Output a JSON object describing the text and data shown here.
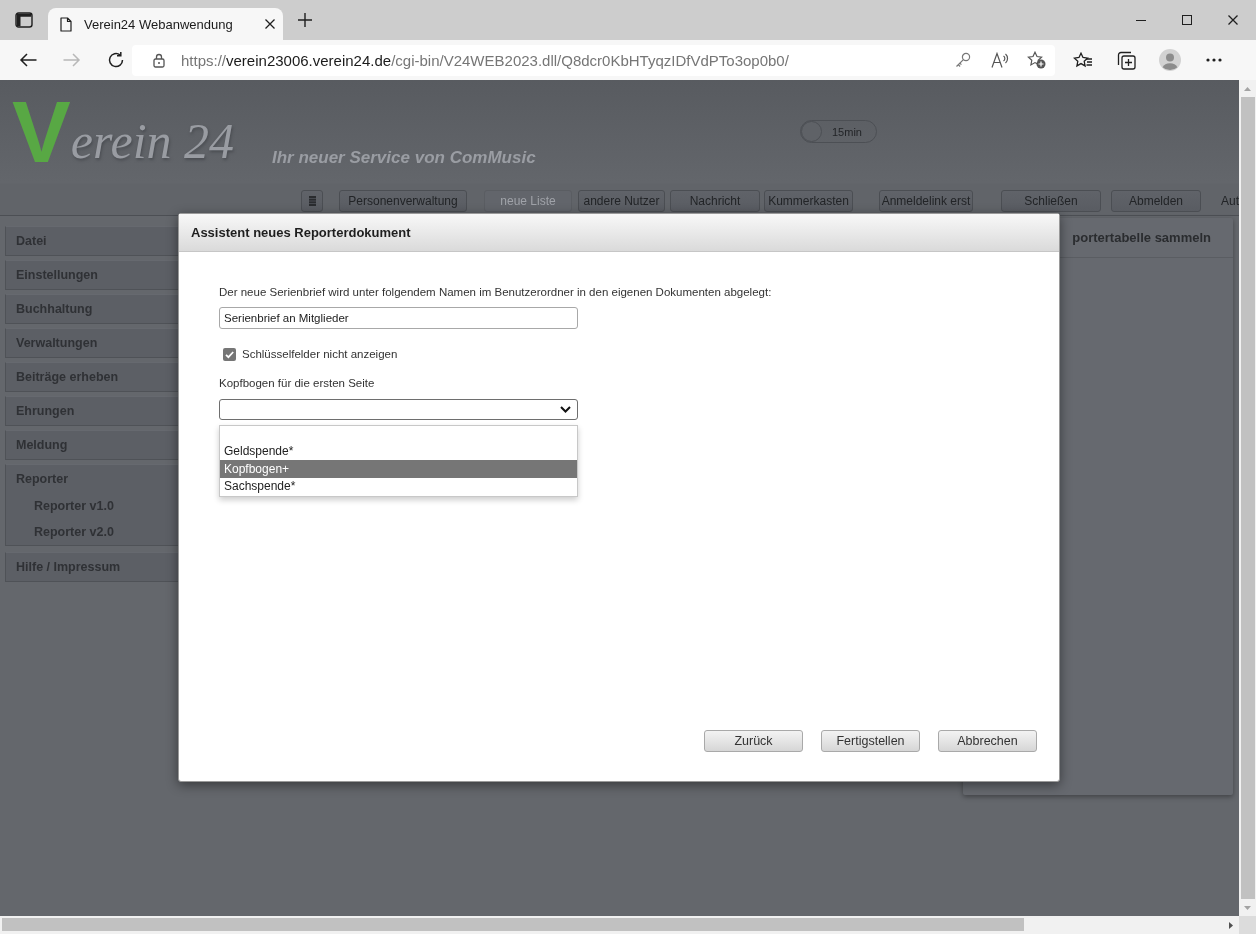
{
  "browser": {
    "tab": {
      "title": "Verein24 Webanwendung"
    },
    "nav": [
      {
        "kind": "back",
        "disabled": false
      },
      {
        "kind": "forward",
        "disabled": true
      },
      {
        "kind": "reload",
        "disabled": false
      }
    ],
    "url": {
      "scheme": "https://",
      "host": "verein23006.verein24.de",
      "path": "/cgi-bin/V24WEB2023.dll/Q8dcr0KbHTyqzIDfVdPTo3op0b0/"
    }
  },
  "header": {
    "logo": {
      "initial": "V",
      "text": "erein 24"
    },
    "tagline": "Ihr neuer Service von ComMusic",
    "timeout_toggle": {
      "label": "15min",
      "on": false
    }
  },
  "toolbar": {
    "buttons": [
      {
        "kind": "icon",
        "disabled": false
      },
      {
        "kind": "text",
        "label": "Personenverwaltung",
        "disabled": false
      },
      {
        "kind": "text",
        "label": "neue Liste",
        "disabled": true
      },
      {
        "kind": "text",
        "label": "andere Nutzer",
        "disabled": false
      },
      {
        "kind": "text",
        "label": "Nachricht",
        "disabled": false
      },
      {
        "kind": "text",
        "label": "Kummerkasten",
        "disabled": false
      },
      {
        "kind": "text",
        "label": "Anmeldelink erst",
        "disabled": false
      },
      {
        "kind": "text",
        "label": "Schließen",
        "disabled": false
      },
      {
        "kind": "text",
        "label": "Abmelden",
        "disabled": false
      }
    ],
    "trailing_text": "Aut"
  },
  "sidebar": {
    "items": [
      {
        "label": "Datei"
      },
      {
        "label": "Einstellungen"
      },
      {
        "label": "Buchhaltung"
      },
      {
        "label": "Verwaltungen"
      },
      {
        "label": "Beiträge erheben"
      },
      {
        "label": "Ehrungen"
      },
      {
        "label": "Meldung"
      },
      {
        "label": "Reporter",
        "children": [
          {
            "label": "Reporter v1.0"
          },
          {
            "label": "Reporter v2.0"
          }
        ]
      },
      {
        "label": "Hilfe / Impressum"
      }
    ]
  },
  "side_panel": {
    "title": "portertabelle sammeln"
  },
  "dialog": {
    "title": "Assistent neues Reporterdokument",
    "description": "Der neue Serienbrief wird unter folgendem Namen im Benutzerordner in den eigenen Dokumenten abgelegt:",
    "name_field": {
      "value": "Serienbrief an Mitglieder"
    },
    "checkbox": {
      "label": "Schlüsselfelder nicht anzeigen",
      "checked": true
    },
    "letterhead": {
      "label": "Kopfbogen für die ersten Seite",
      "expanded": true,
      "options": [
        {
          "label": "Geldspende*",
          "selected": false
        },
        {
          "label": "Kopfbogen+",
          "selected": true
        },
        {
          "label": "Sachspende*",
          "selected": false
        }
      ]
    },
    "buttons": [
      "Zurück",
      "Fertigstellen",
      "Abbrechen"
    ]
  }
}
